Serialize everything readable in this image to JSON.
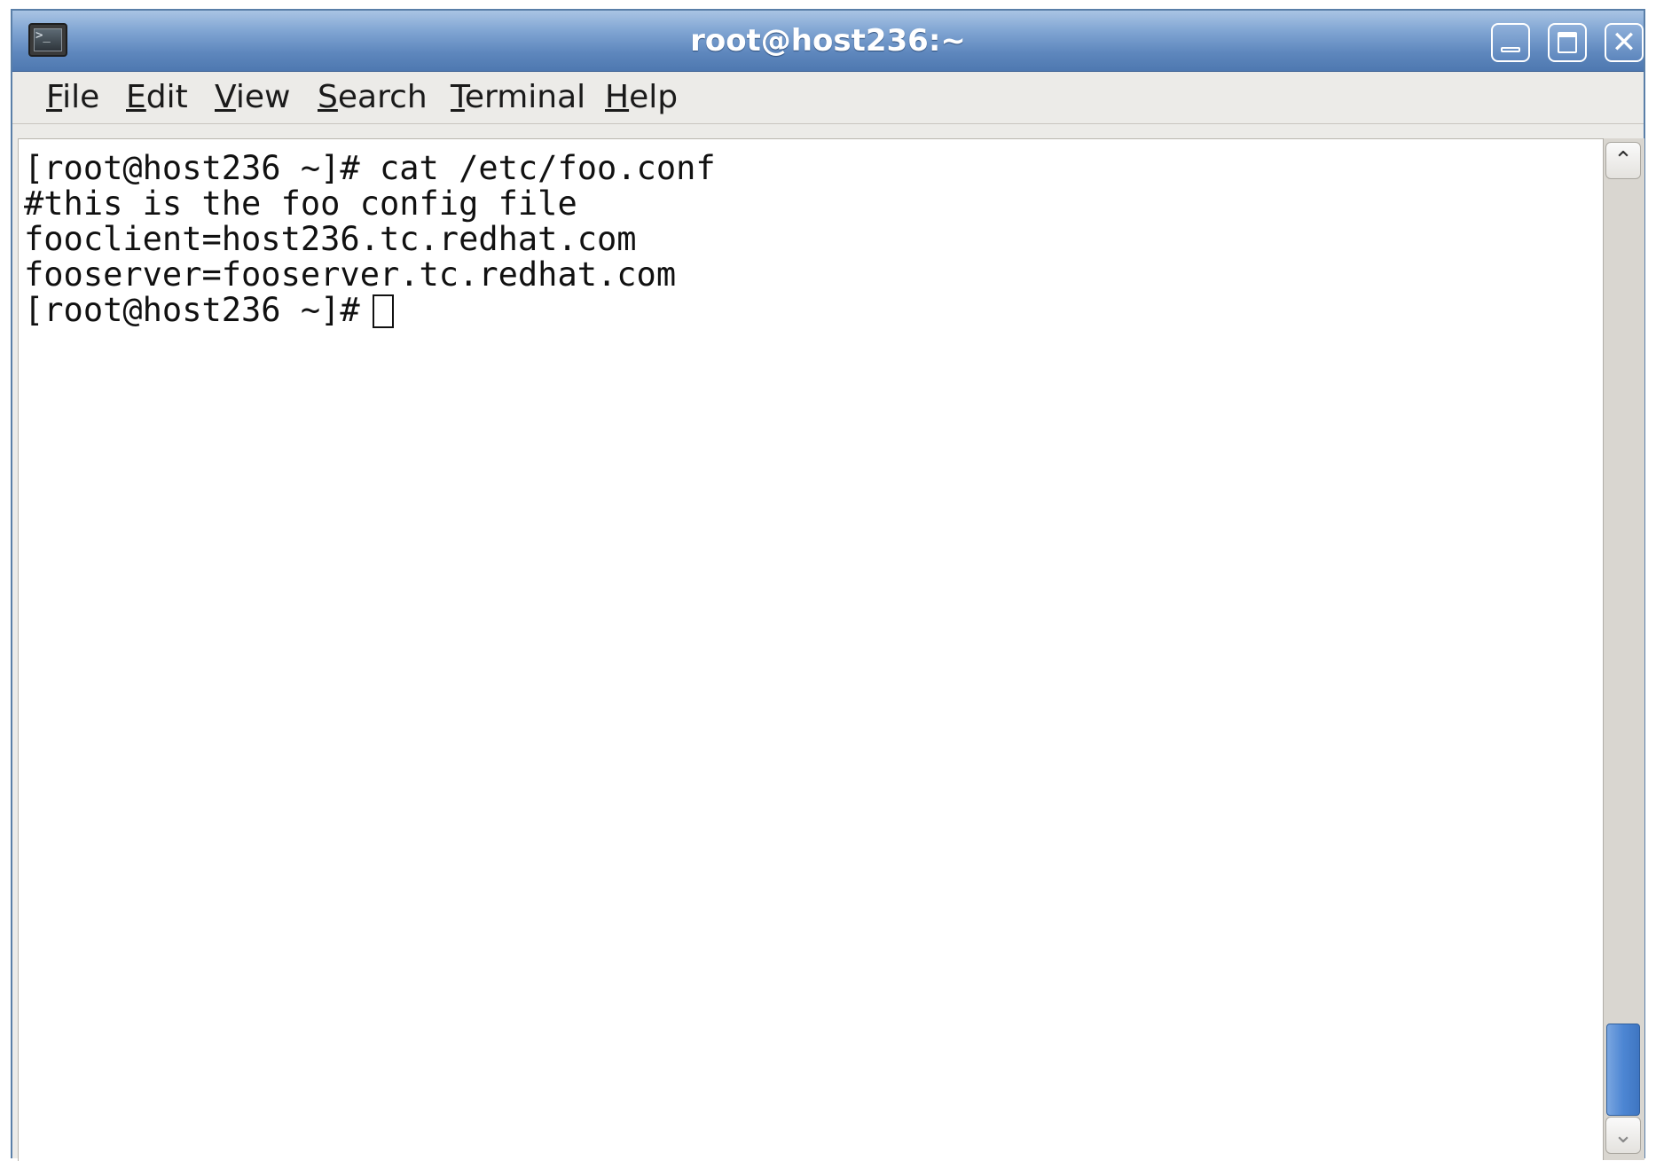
{
  "window": {
    "title": "root@host236:~",
    "icons": {
      "app": "terminal-icon",
      "minimize": "minimize-icon",
      "maximize": "maximize-icon",
      "close": "close-icon"
    },
    "colors": {
      "titlebar": "#5e87bd",
      "scroll_thumb": "#4d86d3",
      "terminal_background": "#ffffff",
      "terminal_text": "#111111"
    }
  },
  "menubar": {
    "items": [
      {
        "mnemonic": "F",
        "rest": "ile"
      },
      {
        "mnemonic": "E",
        "rest": "dit"
      },
      {
        "mnemonic": "V",
        "rest": "iew"
      },
      {
        "mnemonic": "S",
        "rest": "earch"
      },
      {
        "mnemonic": "T",
        "rest": "erminal"
      },
      {
        "mnemonic": "H",
        "rest": "elp"
      }
    ]
  },
  "terminal": {
    "lines": [
      "[root@host236 ~]# cat /etc/foo.conf",
      "#this is the foo config file",
      "fooclient=host236.tc.redhat.com",
      "fooserver=fooserver.tc.redhat.com"
    ],
    "prompt": "[root@host236 ~]#"
  },
  "scrollbar": {
    "up_icon": "chevron-up-icon",
    "down_icon": "chevron-down-icon",
    "position": "bottom"
  }
}
